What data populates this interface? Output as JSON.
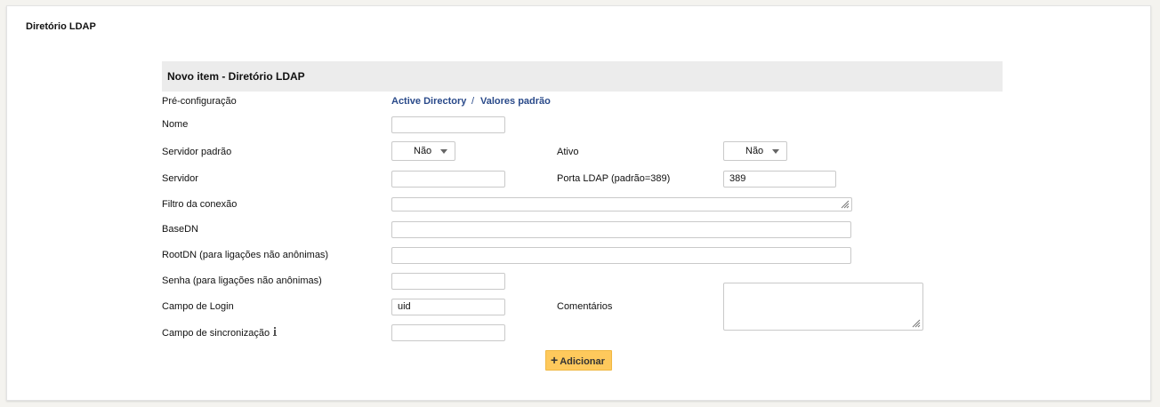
{
  "page": {
    "title": "Diretório LDAP"
  },
  "form": {
    "header": "Novo item - Diretório LDAP",
    "preconfig": {
      "label": "Pré-configuração",
      "links": [
        "Active Directory",
        "Valores padrão"
      ],
      "separator": "/"
    },
    "fields": {
      "nome": {
        "label": "Nome",
        "value": ""
      },
      "servidor_padrao": {
        "label": "Servidor padrão",
        "value": "Não"
      },
      "ativo": {
        "label": "Ativo",
        "value": "Não"
      },
      "servidor": {
        "label": "Servidor",
        "value": ""
      },
      "porta": {
        "label": "Porta LDAP (padrão=389)",
        "value": "389"
      },
      "filtro": {
        "label": "Filtro da conexão",
        "value": ""
      },
      "basedn": {
        "label": "BaseDN",
        "value": ""
      },
      "rootdn": {
        "label": "RootDN (para ligações não anônimas)",
        "value": ""
      },
      "senha": {
        "label": "Senha (para ligações não anônimas)",
        "value": ""
      },
      "campo_login": {
        "label": "Campo de Login",
        "value": "uid"
      },
      "comentarios": {
        "label": "Comentários",
        "value": ""
      },
      "campo_sync": {
        "label": "Campo de sincronização",
        "value": ""
      }
    },
    "submit_label": "Adicionar",
    "icons": {
      "info": "info-icon",
      "plus": "plus-icon"
    }
  }
}
